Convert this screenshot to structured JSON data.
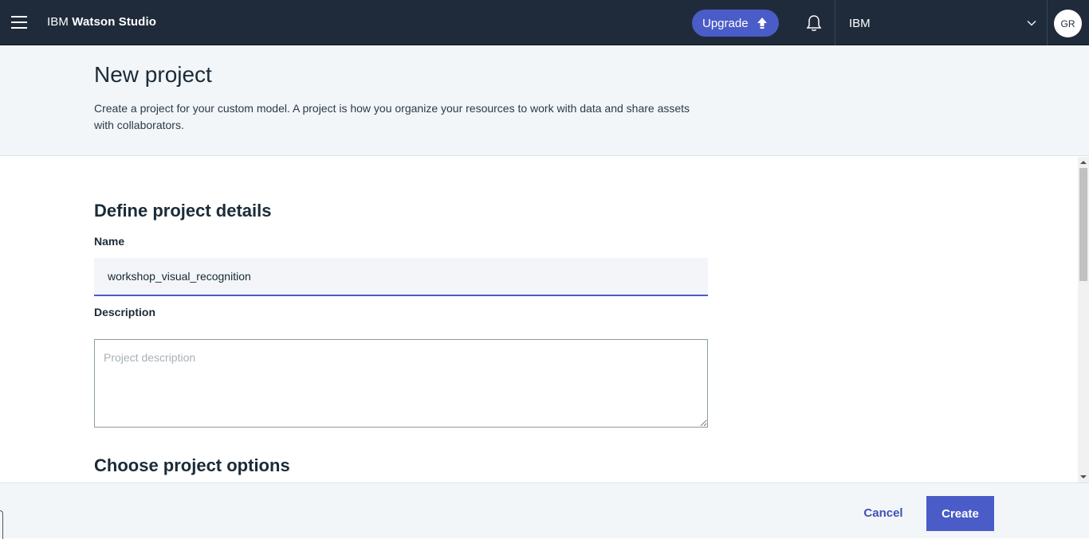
{
  "topbar": {
    "brand_prefix": "IBM ",
    "brand_name": "Watson Studio",
    "upgrade_label": "Upgrade",
    "account_label": "IBM",
    "avatar_initials": "GR"
  },
  "header": {
    "title": "New project",
    "description": "Create a project for your custom model. A project is how you organize your resources to work with data and share assets with collaborators."
  },
  "form": {
    "section_details_title": "Define project details",
    "name_label": "Name",
    "name_value": "workshop_visual_recognition",
    "description_label": "Description",
    "description_placeholder": "Project description",
    "section_options_title": "Choose project options"
  },
  "footer": {
    "cancel_label": "Cancel",
    "create_label": "Create"
  },
  "colors": {
    "nav_bg": "#1f2b3a",
    "accent": "#4a5cc7",
    "header_bg": "#f3f6f9"
  }
}
